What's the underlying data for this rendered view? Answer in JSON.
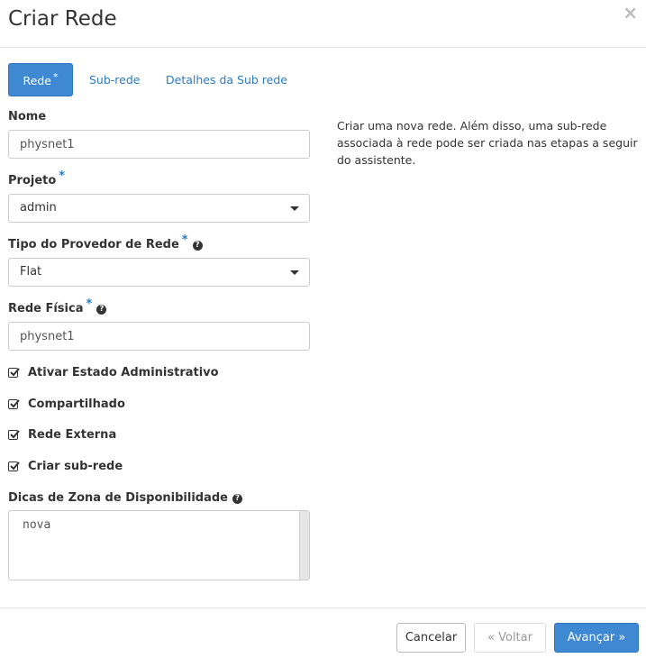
{
  "modal": {
    "title": "Criar Rede",
    "close_glyph": "×"
  },
  "tabs": [
    {
      "label": "Rede",
      "required_mark": "*",
      "active": true
    },
    {
      "label": "Sub-rede",
      "active": false
    },
    {
      "label": "Detalhes da Sub rede",
      "active": false
    }
  ],
  "form": {
    "nome": {
      "label": "Nome",
      "value": "physnet1"
    },
    "projeto": {
      "label": "Projeto",
      "required_mark": "*",
      "value": "admin"
    },
    "tipo_provedor": {
      "label": "Tipo do Provedor de Rede",
      "required_mark": "*",
      "help_glyph": "?",
      "value": "Flat"
    },
    "rede_fisica": {
      "label": "Rede Física",
      "required_mark": "*",
      "help_glyph": "?",
      "value": "physnet1"
    },
    "checkboxes": [
      {
        "label": "Ativar Estado Administrativo",
        "checked": true
      },
      {
        "label": "Compartilhado",
        "checked": true
      },
      {
        "label": "Rede Externa",
        "checked": true
      },
      {
        "label": "Criar sub-rede",
        "checked": true
      }
    ],
    "dicas_zona": {
      "label": "Dicas de Zona de Disponibilidade",
      "help_glyph": "?",
      "value": "nova"
    }
  },
  "description": "Criar uma nova rede. Além disso, uma sub-rede associada à rede pode ser criada nas etapas a seguir do assistente.",
  "footer": {
    "cancel_label": "Cancelar",
    "back_label": "«  Voltar",
    "next_label": "Avançar  »"
  },
  "colors": {
    "accent": "#3f89d3",
    "link": "#2a7bc0"
  },
  "icons": {
    "close": "close-icon",
    "help": "help-circle-icon",
    "caret": "chevron-down-icon",
    "check": "checkbox-checked-icon"
  }
}
